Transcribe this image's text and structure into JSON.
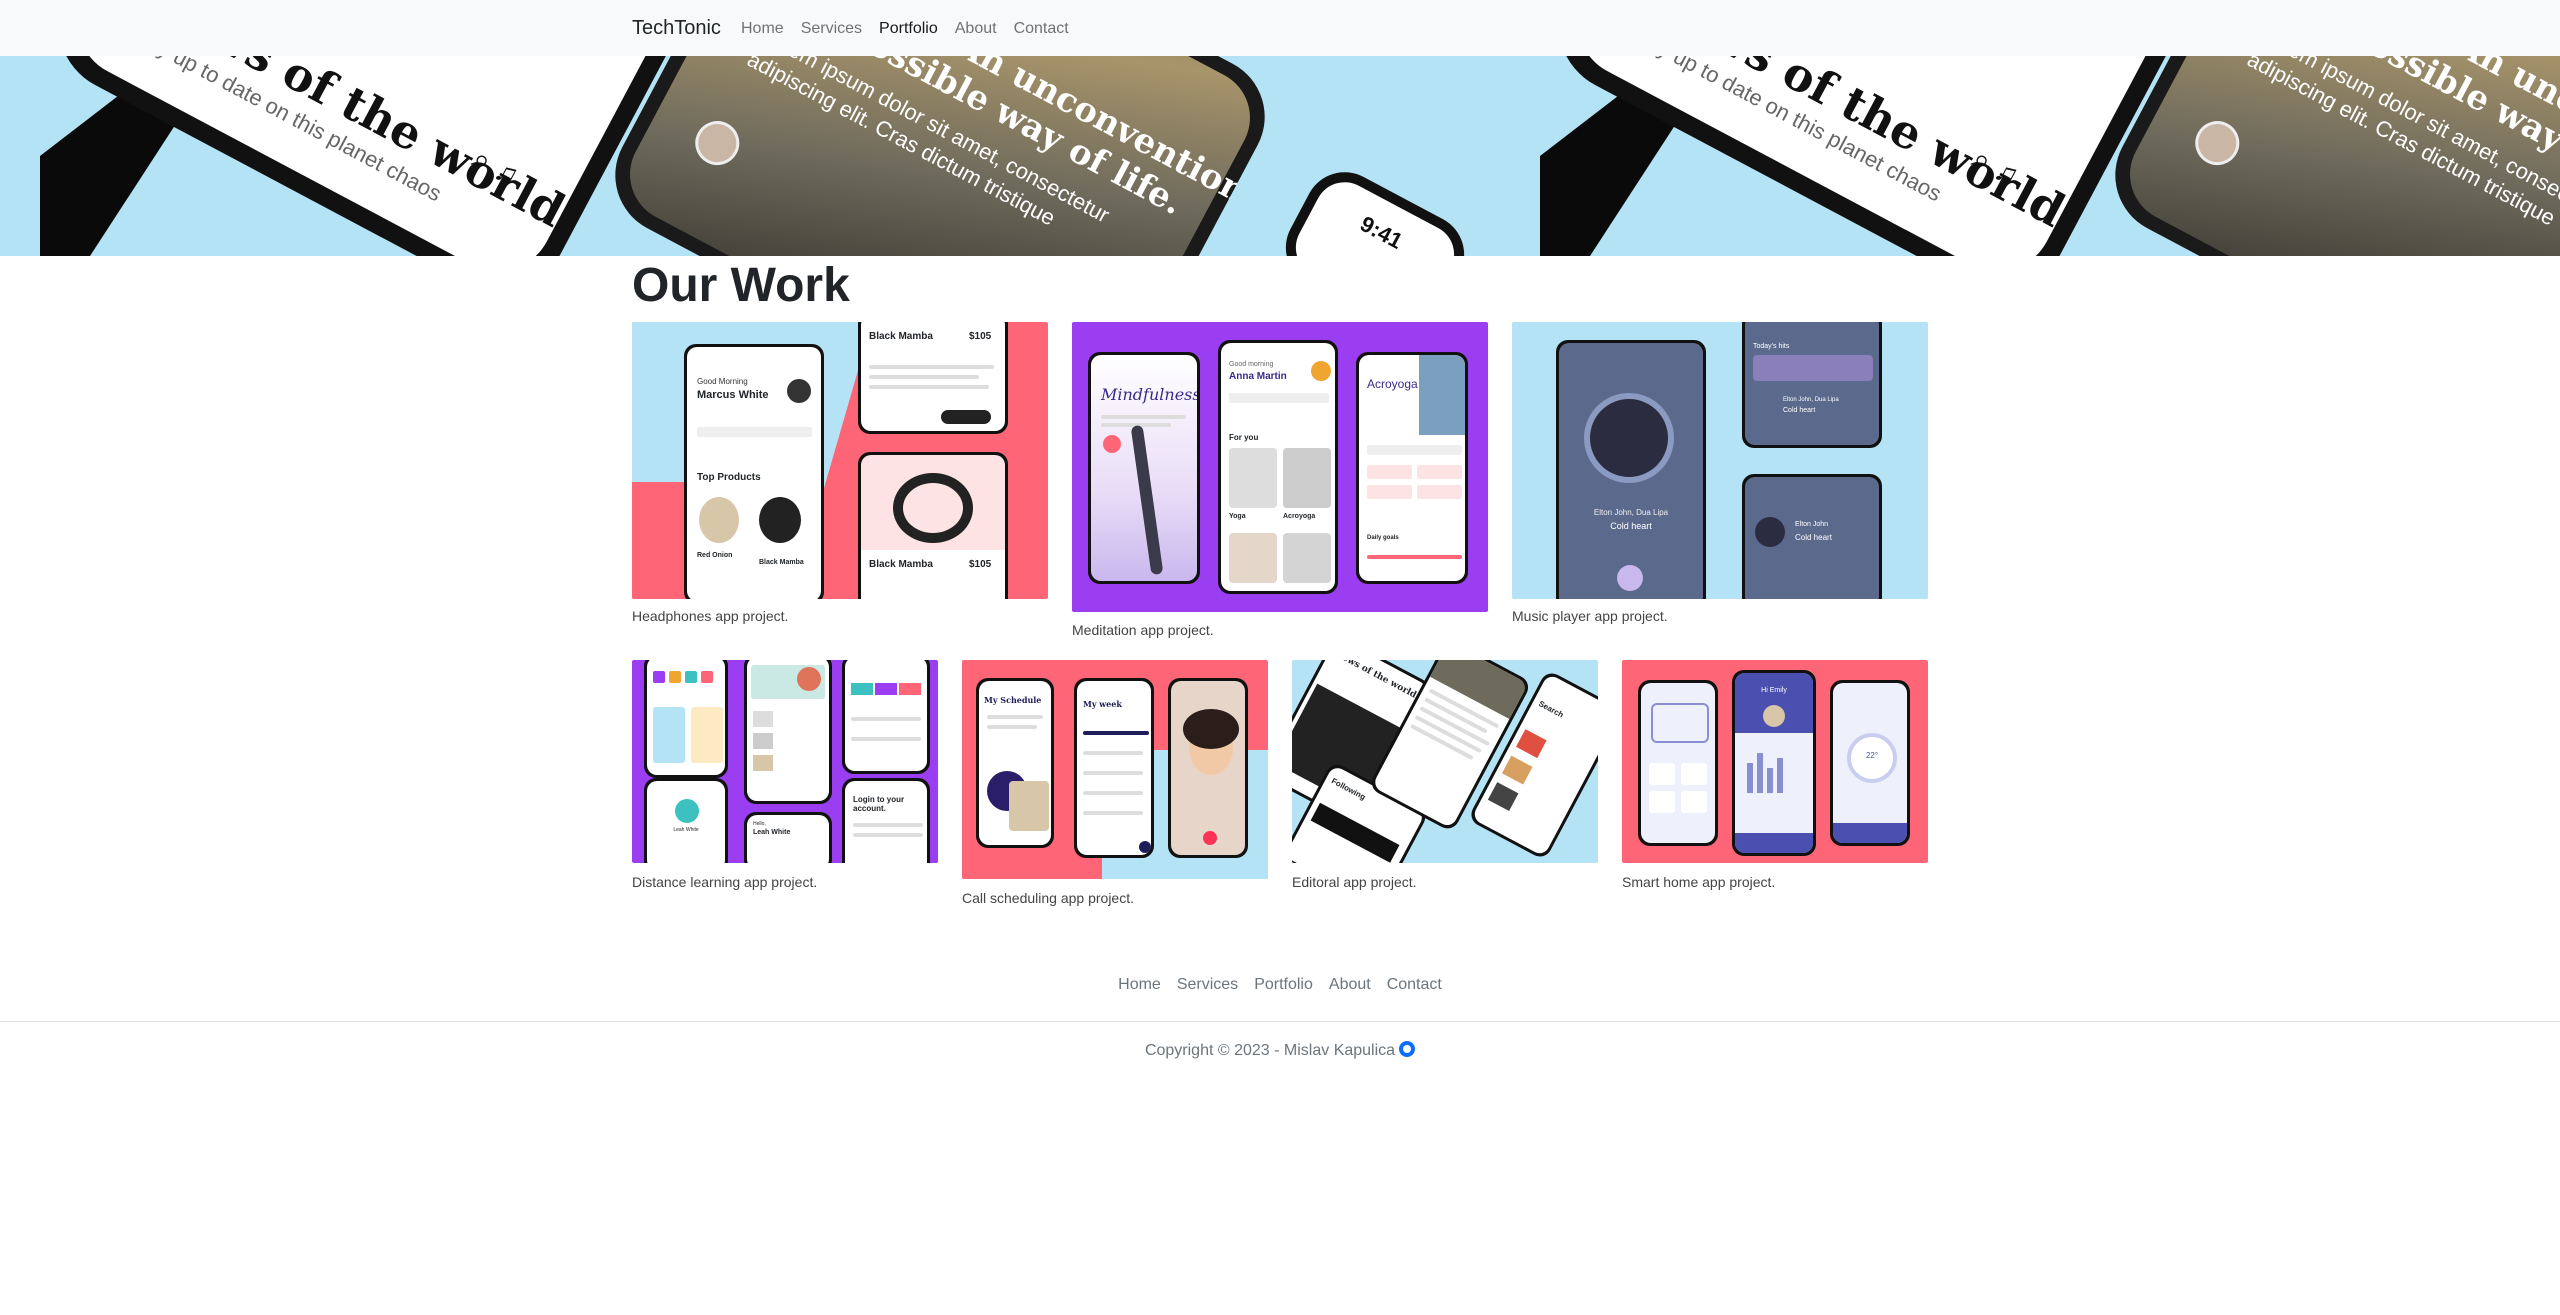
{
  "navbar": {
    "brand": "TechTonic",
    "links": [
      "Home",
      "Services",
      "Portfolio",
      "About",
      "Contact"
    ],
    "active": "Portfolio"
  },
  "hero": {
    "news_title": "News of the world",
    "news_subtitle": "Stay up to date on this planet chaos",
    "nomad_title_line1": "Nomads. An unconventional",
    "nomad_title_line2": "but possible way of life.",
    "nomad_text_line1": "Lorem ipsum dolor sit amet, consectetur",
    "nomad_text_line2": "adipiscing elit. Cras dictum tristique",
    "phone_time": "9:41",
    "colors": {
      "background": "#b3e3f5"
    }
  },
  "main": {
    "title": "Our Work",
    "projects": [
      {
        "caption": "Headphones app project.",
        "bg": "#fe6677",
        "accent": "#b3e3f5",
        "texts": [
          "Black Mamba",
          "$105",
          "Good Morning",
          "Marcus White",
          "Top Products",
          "Red Onion",
          "Black Mamba",
          "Black Mamba",
          "$105"
        ]
      },
      {
        "caption": "Meditation app project.",
        "bg": "#9b3df0",
        "texts": [
          "Mindfulness",
          "Good morning",
          "Anna Martin",
          "Acroyoga",
          "For you",
          "Yoga",
          "Acroyoga",
          "Daily goals"
        ]
      },
      {
        "caption": "Music player app project.",
        "bg": "#b3e3f5",
        "texts": [
          "Elton John, Dua Lipa",
          "Cold heart",
          "Today's hits",
          "Elton John, Dua Lipa",
          "Cold heart",
          "Elton John",
          "Cold heart"
        ]
      },
      {
        "caption": "Distance learning app project.",
        "bg": "#9b3df0",
        "texts": [
          "Login to your account.",
          "Leah White",
          "Hello,",
          "Leah White"
        ]
      },
      {
        "caption": "Call scheduling app project.",
        "bg": "#fe6677",
        "accent": "#b3e3f5",
        "texts": [
          "My Schedule",
          "My week"
        ]
      },
      {
        "caption": "Editoral app project.",
        "bg": "#b3e3f5",
        "texts": [
          "News of the world",
          "Following",
          "Search"
        ]
      },
      {
        "caption": "Smart home app project.",
        "bg": "#fe6677",
        "texts": [
          "Hi Emily",
          "22°"
        ]
      }
    ]
  },
  "footer": {
    "links": [
      "Home",
      "Services",
      "Portfolio",
      "About",
      "Contact"
    ],
    "copyright": "Copyright © 2023 - Mislav Kapulica"
  }
}
